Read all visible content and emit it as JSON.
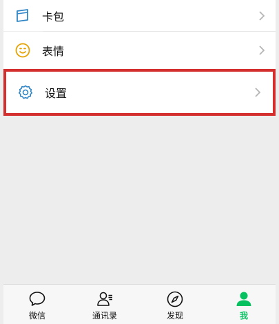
{
  "menu": {
    "card": {
      "label": "卡包",
      "icon": "card-wallet-icon"
    },
    "emoji": {
      "label": "表情",
      "icon": "emoji-smile-icon"
    },
    "settings": {
      "label": "设置",
      "icon": "gear-icon"
    }
  },
  "tabbar": {
    "items": [
      {
        "label": "微信",
        "icon": "chat-bubble-icon",
        "active": false
      },
      {
        "label": "通讯录",
        "icon": "contacts-icon",
        "active": false
      },
      {
        "label": "发现",
        "icon": "compass-icon",
        "active": false
      },
      {
        "label": "我",
        "icon": "person-icon",
        "active": true
      }
    ]
  },
  "colors": {
    "accent": "#07c160",
    "highlight": "#d32f2f",
    "icon_blue": "#2f86c7",
    "icon_yellow": "#e5a100"
  }
}
